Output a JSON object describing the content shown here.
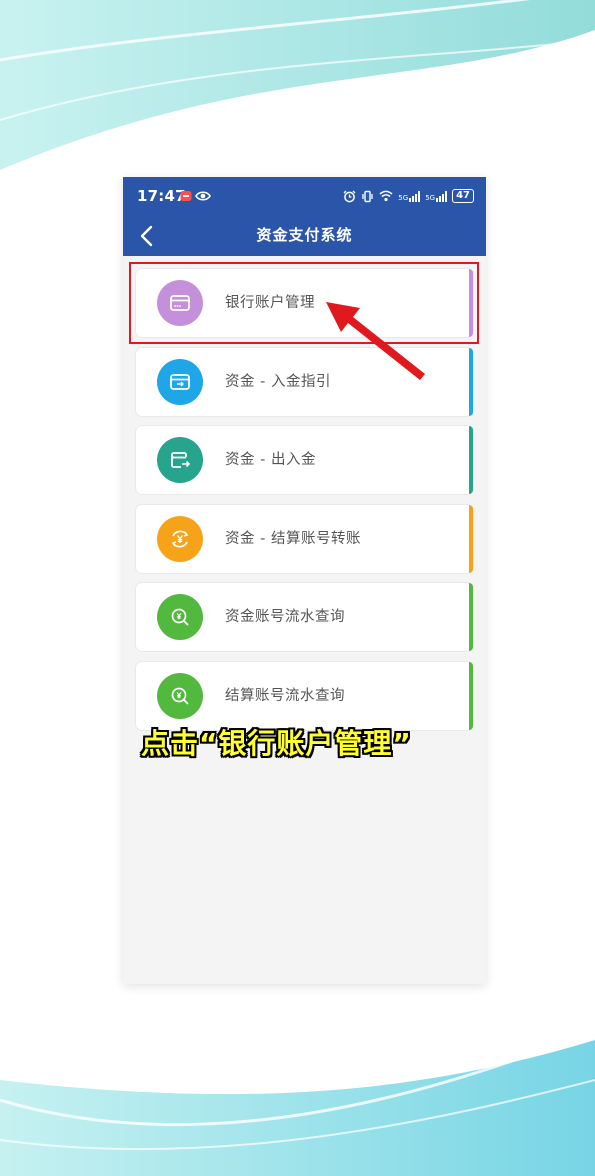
{
  "status_bar": {
    "time": "17:47",
    "battery": "47",
    "signal_labels": [
      "5G",
      "5G"
    ]
  },
  "nav": {
    "title": "资金支付系统"
  },
  "menu": {
    "items": [
      {
        "label": "银行账户管理",
        "icon": "bank-card-icon",
        "color": "#c490dc",
        "stripe": "#c490dc"
      },
      {
        "label": "资金 - 入金指引",
        "icon": "card-guide-icon",
        "color": "#1fa6e6",
        "stripe": "#1fa6e6"
      },
      {
        "label": "资金 - 出入金",
        "icon": "wallet-transfer-icon",
        "color": "#26a48e",
        "stripe": "#26a48e"
      },
      {
        "label": "资金 - 结算账号转账",
        "icon": "yuan-exchange-icon",
        "color": "#f7a31a",
        "stripe": "#f7a31a"
      },
      {
        "label": "资金账号流水查询",
        "icon": "yuan-search-icon",
        "color": "#52b83e",
        "stripe": "#52b83e"
      },
      {
        "label": "结算账号流水查询",
        "icon": "yuan-search-icon",
        "color": "#52b83e",
        "stripe": "#52b83e"
      }
    ]
  },
  "annotation": {
    "caption": "点击“银行账户管理”",
    "highlight_color": "#e0191e"
  }
}
